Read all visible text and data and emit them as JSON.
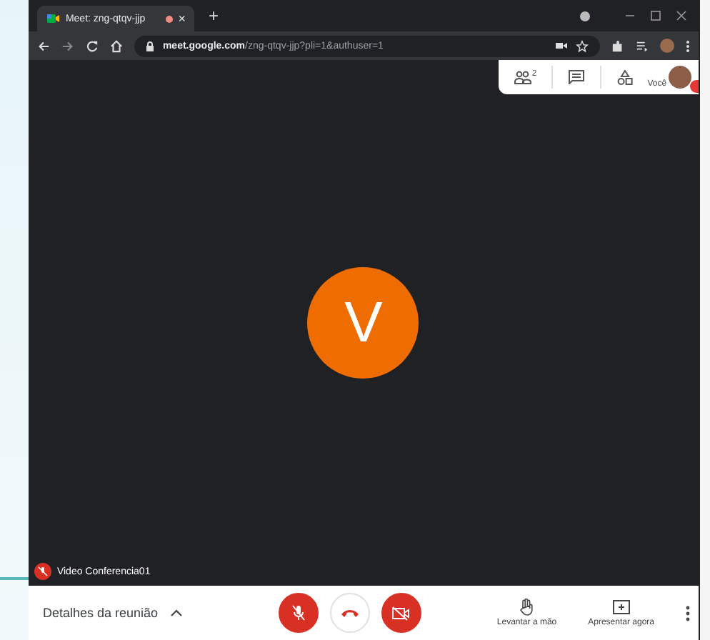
{
  "browser": {
    "tab": {
      "title": "Meet: zng-qtqv-jjp",
      "recording": true,
      "close": "×"
    },
    "new_tab": "+",
    "address": {
      "domain": "meet.google.com",
      "path": "/zng-qtqv-jjp?pli=1&authuser=1"
    }
  },
  "meet": {
    "top_panel": {
      "participants_count": "2",
      "self_label": "Você"
    },
    "avatar_letter": "V",
    "participant": {
      "name": "Video Conferencia01",
      "muted": true
    }
  },
  "controls": {
    "details": {
      "label": "Detalhes da reunião",
      "expanded": false
    },
    "mic": {
      "muted": true
    },
    "camera": {
      "off": true
    },
    "actions": [
      {
        "kind": "hand",
        "label": "Levantar a mão"
      },
      {
        "kind": "present",
        "label": "Apresentar agora"
      }
    ]
  }
}
